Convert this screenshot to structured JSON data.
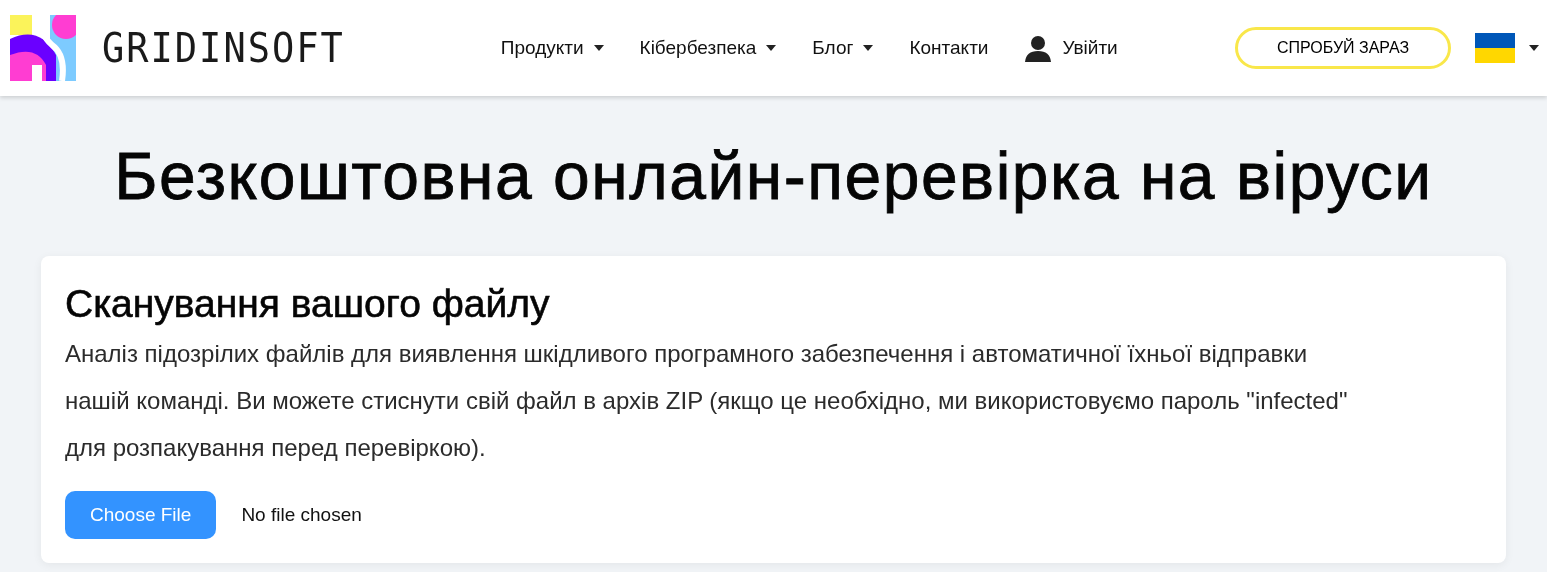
{
  "header": {
    "logo_text": "GRIDINSOFT",
    "nav": [
      {
        "label": "Продукти",
        "has_dropdown": true
      },
      {
        "label": "Кібербезпека",
        "has_dropdown": true
      },
      {
        "label": "Блог",
        "has_dropdown": true
      },
      {
        "label": "Контакти",
        "has_dropdown": false
      }
    ],
    "login": "Увійти",
    "cta": "СПРОБУЙ ЗАРАЗ",
    "language": {
      "has_dropdown": true
    }
  },
  "page_title": "Безкоштовна онлайн-перевірка на віруси",
  "card": {
    "title": "Сканування вашого файлу",
    "description": "Аналіз підозрілих файлів для виявлення шкідливого програмного забезпечення і автоматичної їхньої відправки нашій команді. Ви можете стиснути свій файл в архів ZIP (якщо це необхідно, ми використовуємо пароль \"infected\" для розпакування перед перевіркою).",
    "file_button": "Choose File",
    "file_status": "No file chosen"
  }
}
